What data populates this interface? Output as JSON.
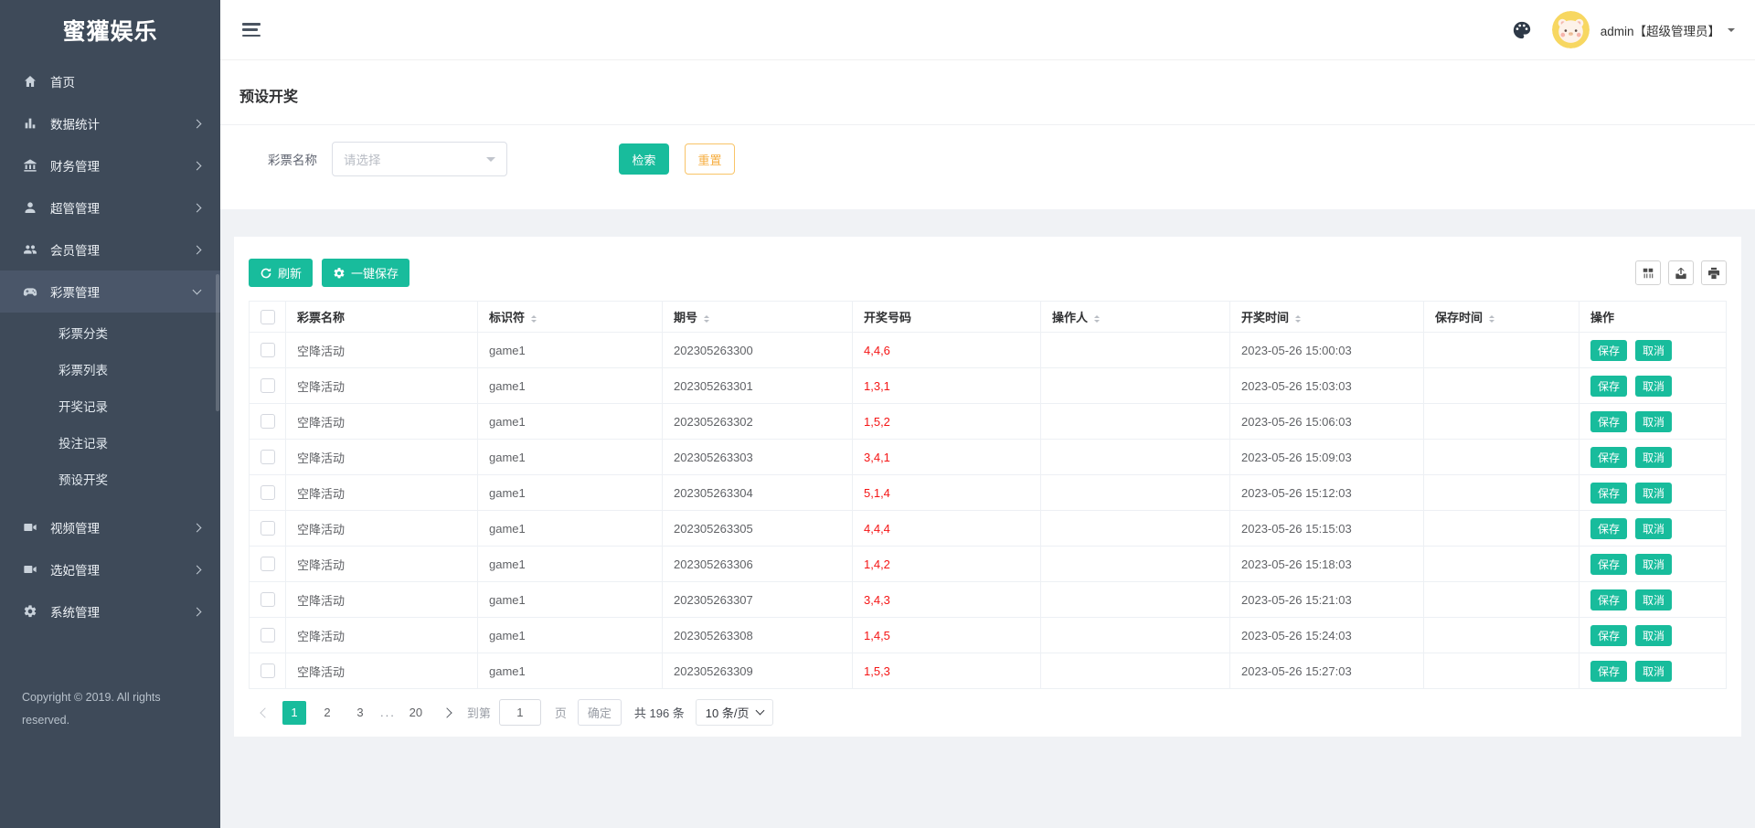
{
  "app": {
    "name": "蜜獾娱乐",
    "copyright": "Copyright © 2019. All rights reserved."
  },
  "header": {
    "user_label": "admin【超级管理员】",
    "icons": [
      "hamburger-icon",
      "palette-icon",
      "avatar",
      "chevron-down-icon"
    ]
  },
  "sidebar": {
    "items": [
      {
        "key": "home",
        "label": "首页",
        "icon": "home-icon",
        "arrow": "none",
        "active": false
      },
      {
        "key": "stats",
        "label": "数据统计",
        "icon": "chart-icon",
        "arrow": "right",
        "active": false
      },
      {
        "key": "finance",
        "label": "财务管理",
        "icon": "bank-icon",
        "arrow": "right",
        "active": false
      },
      {
        "key": "admins",
        "label": "超管管理",
        "icon": "admin-icon",
        "arrow": "right",
        "active": false
      },
      {
        "key": "members",
        "label": "会员管理",
        "icon": "members-icon",
        "arrow": "right",
        "active": false
      },
      {
        "key": "lottery",
        "label": "彩票管理",
        "icon": "lottery-icon",
        "arrow": "down",
        "active": true,
        "children": [
          "彩票分类",
          "彩票列表",
          "开奖记录",
          "投注记录",
          "预设开奖"
        ]
      },
      {
        "key": "video",
        "label": "视频管理",
        "icon": "video-icon",
        "arrow": "right",
        "active": false
      },
      {
        "key": "consort",
        "label": "选妃管理",
        "icon": "video-icon",
        "arrow": "right",
        "active": false
      },
      {
        "key": "system",
        "label": "系统管理",
        "icon": "gear-icon",
        "arrow": "right",
        "active": false
      }
    ]
  },
  "page": {
    "title": "预设开奖"
  },
  "filter": {
    "label": "彩票名称",
    "placeholder": "请选择",
    "search": "检索",
    "reset": "重置"
  },
  "toolbar": {
    "refresh": "刷新",
    "save_all": "一键保存",
    "right_icons": [
      "columns-icon",
      "export-icon",
      "print-icon"
    ]
  },
  "table": {
    "columns": [
      {
        "label": "",
        "type": "checkbox",
        "sortable": false
      },
      {
        "label": "彩票名称",
        "sortable": false
      },
      {
        "label": "标识符",
        "sortable": true
      },
      {
        "label": "期号",
        "sortable": true
      },
      {
        "label": "开奖号码",
        "sortable": false
      },
      {
        "label": "操作人",
        "sortable": true
      },
      {
        "label": "开奖时间",
        "sortable": true
      },
      {
        "label": "保存时间",
        "sortable": true
      },
      {
        "label": "操作",
        "sortable": false
      }
    ],
    "actions": {
      "save": "保存",
      "cancel": "取消"
    },
    "rows": [
      {
        "name": "空降活动",
        "code": "game1",
        "issue": "202305263300",
        "numbers": "4,4,6",
        "operator": "",
        "draw_time": "2023-05-26 15:00:03",
        "save_time": ""
      },
      {
        "name": "空降活动",
        "code": "game1",
        "issue": "202305263301",
        "numbers": "1,3,1",
        "operator": "",
        "draw_time": "2023-05-26 15:03:03",
        "save_time": ""
      },
      {
        "name": "空降活动",
        "code": "game1",
        "issue": "202305263302",
        "numbers": "1,5,2",
        "operator": "",
        "draw_time": "2023-05-26 15:06:03",
        "save_time": ""
      },
      {
        "name": "空降活动",
        "code": "game1",
        "issue": "202305263303",
        "numbers": "3,4,1",
        "operator": "",
        "draw_time": "2023-05-26 15:09:03",
        "save_time": ""
      },
      {
        "name": "空降活动",
        "code": "game1",
        "issue": "202305263304",
        "numbers": "5,1,4",
        "operator": "",
        "draw_time": "2023-05-26 15:12:03",
        "save_time": ""
      },
      {
        "name": "空降活动",
        "code": "game1",
        "issue": "202305263305",
        "numbers": "4,4,4",
        "operator": "",
        "draw_time": "2023-05-26 15:15:03",
        "save_time": ""
      },
      {
        "name": "空降活动",
        "code": "game1",
        "issue": "202305263306",
        "numbers": "1,4,2",
        "operator": "",
        "draw_time": "2023-05-26 15:18:03",
        "save_time": ""
      },
      {
        "name": "空降活动",
        "code": "game1",
        "issue": "202305263307",
        "numbers": "3,4,3",
        "operator": "",
        "draw_time": "2023-05-26 15:21:03",
        "save_time": ""
      },
      {
        "name": "空降活动",
        "code": "game1",
        "issue": "202305263308",
        "numbers": "1,4,5",
        "operator": "",
        "draw_time": "2023-05-26 15:24:03",
        "save_time": ""
      },
      {
        "name": "空降活动",
        "code": "game1",
        "issue": "202305263309",
        "numbers": "1,5,3",
        "operator": "",
        "draw_time": "2023-05-26 15:27:03",
        "save_time": ""
      }
    ]
  },
  "pagination": {
    "pages": [
      "1",
      "2",
      "3",
      "...",
      "20"
    ],
    "active": "1",
    "jump_prefix": "到第",
    "jump_value": "1",
    "jump_suffix": "页",
    "confirm": "确定",
    "total": "共 196 条",
    "page_size": "10 条/页"
  },
  "colors": {
    "accent_teal": "#18bc9c",
    "warning_yellow": "#f6ae41",
    "danger_red": "#f51515",
    "sidebar_bg": "#3e4a59"
  }
}
